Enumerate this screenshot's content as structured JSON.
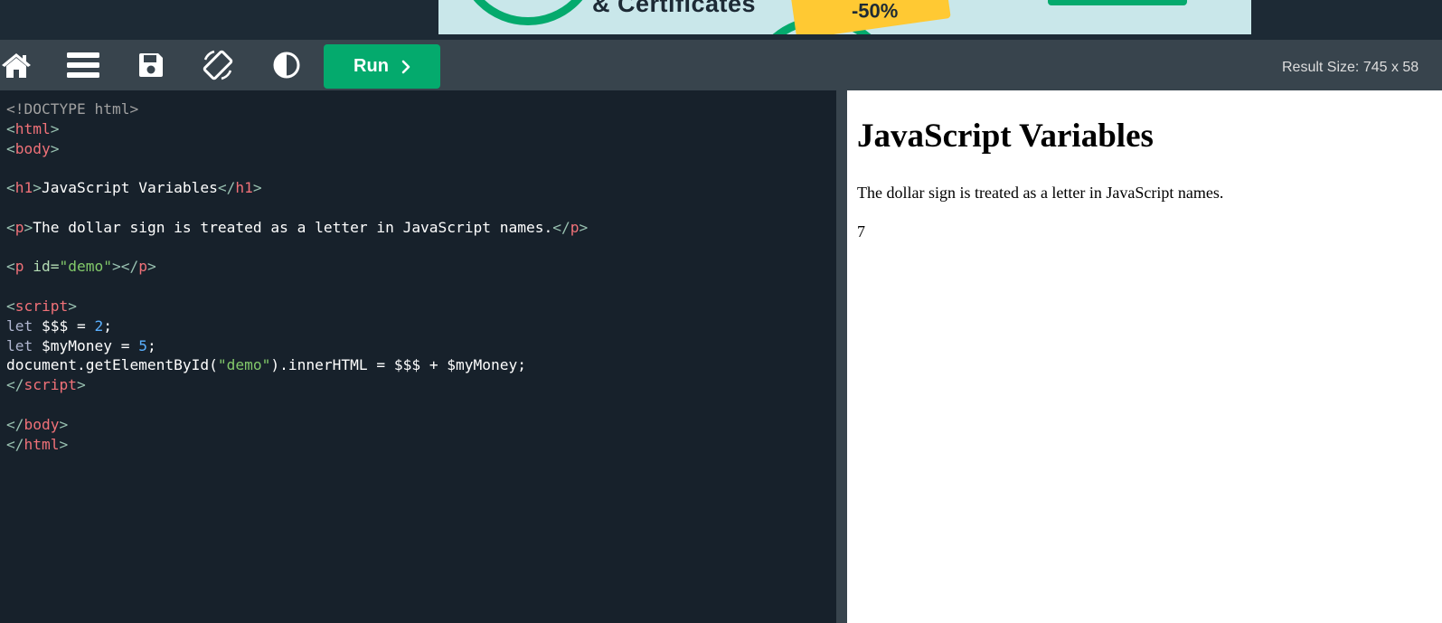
{
  "toolbar": {
    "icons": [
      "home-icon",
      "menu-icon",
      "save-icon",
      "rotate-icon",
      "contrast-icon"
    ],
    "run_label": "Run",
    "result_size": "Result Size: 745 x 58"
  },
  "ad": {
    "headline": "& Certificates",
    "discount": "-50%",
    "colors": {
      "accent": "#04aa6d",
      "badge": "#ffc933",
      "background": "#c9e7ea"
    }
  },
  "editor": {
    "lines": [
      [
        {
          "t": "<!DOCTYPE html>",
          "c": "doctype"
        }
      ],
      [
        {
          "t": "<",
          "c": "bracket"
        },
        {
          "t": "html",
          "c": "tag"
        },
        {
          "t": ">",
          "c": "bracket"
        }
      ],
      [
        {
          "t": "<",
          "c": "bracket"
        },
        {
          "t": "body",
          "c": "tag"
        },
        {
          "t": ">",
          "c": "bracket"
        }
      ],
      [],
      [
        {
          "t": "<",
          "c": "bracket"
        },
        {
          "t": "h1",
          "c": "tag"
        },
        {
          "t": ">",
          "c": "bracket"
        },
        {
          "t": "JavaScript Variables",
          "c": "text"
        },
        {
          "t": "</",
          "c": "bracket"
        },
        {
          "t": "h1",
          "c": "tag"
        },
        {
          "t": ">",
          "c": "bracket"
        }
      ],
      [],
      [
        {
          "t": "<",
          "c": "bracket"
        },
        {
          "t": "p",
          "c": "tag"
        },
        {
          "t": ">",
          "c": "bracket"
        },
        {
          "t": "The dollar sign is treated as a letter in JavaScript names.",
          "c": "text"
        },
        {
          "t": "</",
          "c": "bracket"
        },
        {
          "t": "p",
          "c": "tag"
        },
        {
          "t": ">",
          "c": "bracket"
        }
      ],
      [],
      [
        {
          "t": "<",
          "c": "bracket"
        },
        {
          "t": "p",
          "c": "tag"
        },
        {
          "t": " id=",
          "c": "attr"
        },
        {
          "t": "\"demo\"",
          "c": "str"
        },
        {
          "t": "></",
          "c": "bracket"
        },
        {
          "t": "p",
          "c": "tag"
        },
        {
          "t": ">",
          "c": "bracket"
        }
      ],
      [],
      [
        {
          "t": "<",
          "c": "bracket"
        },
        {
          "t": "script",
          "c": "tag"
        },
        {
          "t": ">",
          "c": "bracket"
        }
      ],
      [
        {
          "t": "let",
          "c": "kw"
        },
        {
          "t": " $$$ = ",
          "c": "text"
        },
        {
          "t": "2",
          "c": "num"
        },
        {
          "t": ";",
          "c": "text"
        }
      ],
      [
        {
          "t": "let",
          "c": "kw"
        },
        {
          "t": " $myMoney = ",
          "c": "text"
        },
        {
          "t": "5",
          "c": "num"
        },
        {
          "t": ";",
          "c": "text"
        }
      ],
      [
        {
          "t": "document.getElementById(",
          "c": "text"
        },
        {
          "t": "\"demo\"",
          "c": "str"
        },
        {
          "t": ").innerHTML = $$$ + $myMoney;",
          "c": "text"
        }
      ],
      [
        {
          "t": "</",
          "c": "bracket"
        },
        {
          "t": "script",
          "c": "tag"
        },
        {
          "t": ">",
          "c": "bracket"
        }
      ],
      [],
      [
        {
          "t": "</",
          "c": "bracket"
        },
        {
          "t": "body",
          "c": "tag"
        },
        {
          "t": ">",
          "c": "bracket"
        }
      ],
      [
        {
          "t": "</",
          "c": "bracket"
        },
        {
          "t": "html",
          "c": "tag"
        },
        {
          "t": ">",
          "c": "bracket"
        }
      ]
    ]
  },
  "result": {
    "heading": "JavaScript Variables",
    "paragraph": "The dollar sign is treated as a letter in JavaScript names.",
    "demo_output": "7"
  }
}
